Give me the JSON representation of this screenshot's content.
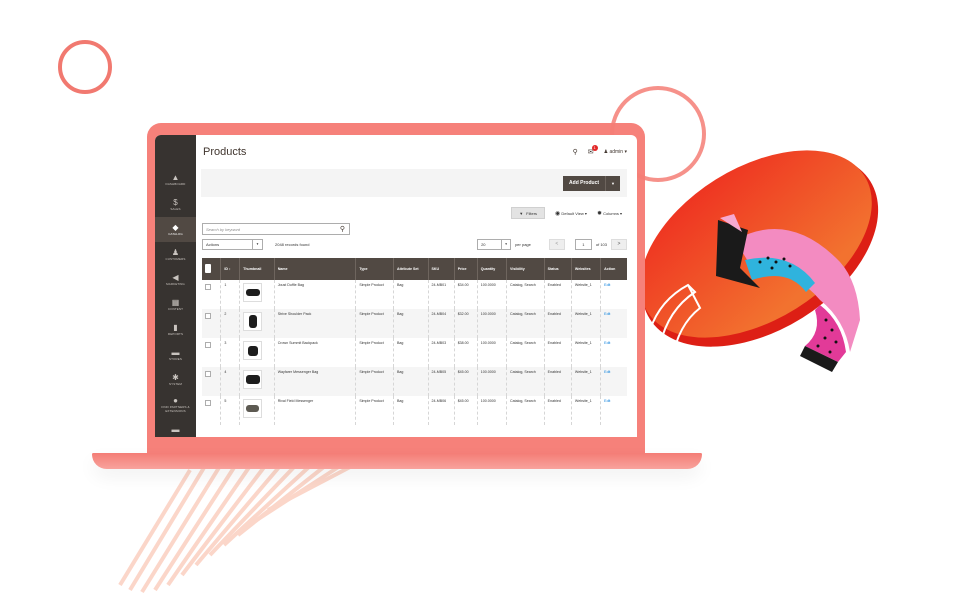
{
  "page": {
    "title": "Products"
  },
  "header": {
    "search_icon": "search-icon",
    "notifications": {
      "icon": "bell-icon",
      "count": "1"
    },
    "user": {
      "icon": "user-icon",
      "label": "admin ▾"
    },
    "add_product": "Add Product",
    "add_product_caret": "▼"
  },
  "sidebar": {
    "items": [
      {
        "label": "Dashboard",
        "icon": "▲",
        "active": false
      },
      {
        "label": "Sales",
        "icon": "$",
        "active": false
      },
      {
        "label": "Catalog",
        "icon": "◆",
        "active": true
      },
      {
        "label": "Customers",
        "icon": "♟",
        "active": false
      },
      {
        "label": "Marketing",
        "icon": "◀",
        "active": false
      },
      {
        "label": "Content",
        "icon": "▦",
        "active": false
      },
      {
        "label": "Reports",
        "icon": "▮",
        "active": false
      },
      {
        "label": "Stores",
        "icon": "▬",
        "active": false
      },
      {
        "label": "System",
        "icon": "✱",
        "active": false
      },
      {
        "label": "Find Partners & Extensions",
        "icon": "●",
        "active": false
      },
      {
        "label": "",
        "icon": "▬",
        "active": false
      }
    ]
  },
  "toolbar": {
    "filters": "Filters",
    "filters_icon": "▼",
    "default_view": "Default View ▾",
    "columns": "Columns ▾",
    "search_placeholder": "Search by keyword",
    "actions": "Actions",
    "records_found": "2048 records found",
    "per_page_value": "20",
    "per_page_label": "per page",
    "prev": "<",
    "next": ">",
    "current_page": "1",
    "of_pages": "of 103"
  },
  "table": {
    "columns": [
      "",
      "ID ↕",
      "Thumbnail",
      "Name",
      "Type",
      "Attribute Set",
      "SKU",
      "Price",
      "Quantity",
      "Visibility",
      "Status",
      "Websites",
      "Action"
    ],
    "rows": [
      {
        "id": "1",
        "name": "Joust Duffle Bag",
        "type": "Simple Product",
        "attr_set": "Bag",
        "sku": "24-MB01",
        "price": "$34.00",
        "qty": "100.0000",
        "visibility": "Catalog, Search",
        "status": "Enabled",
        "websites": "Website_1",
        "action": "Edit"
      },
      {
        "id": "2",
        "name": "Strive Shoulder Pack",
        "type": "Simple Product",
        "attr_set": "Bag",
        "sku": "24-MB04",
        "price": "$32.00",
        "qty": "100.0000",
        "visibility": "Catalog, Search",
        "status": "Enabled",
        "websites": "Website_1",
        "action": "Edit"
      },
      {
        "id": "3",
        "name": "Crown Summit Backpack",
        "type": "Simple Product",
        "attr_set": "Bag",
        "sku": "24-MB03",
        "price": "$38.00",
        "qty": "100.0000",
        "visibility": "Catalog, Search",
        "status": "Enabled",
        "websites": "Website_1",
        "action": "Edit"
      },
      {
        "id": "4",
        "name": "Wayfarer Messenger Bag",
        "type": "Simple Product",
        "attr_set": "Bag",
        "sku": "24-MB05",
        "price": "$45.00",
        "qty": "100.0000",
        "visibility": "Catalog, Search",
        "status": "Enabled",
        "websites": "Website_1",
        "action": "Edit"
      },
      {
        "id": "5",
        "name": "Rival Field Messenger",
        "type": "Simple Product",
        "attr_set": "Bag",
        "sku": "24-MB06",
        "price": "$45.00",
        "qty": "100.0000",
        "visibility": "Catalog, Search",
        "status": "Enabled",
        "websites": "Website_1",
        "action": "Edit"
      }
    ]
  },
  "colors": {
    "laptop": "#f6817a",
    "sidebar": "#373330",
    "header_row": "#514943",
    "accent_red": "#ea3323",
    "link": "#007bdb"
  }
}
